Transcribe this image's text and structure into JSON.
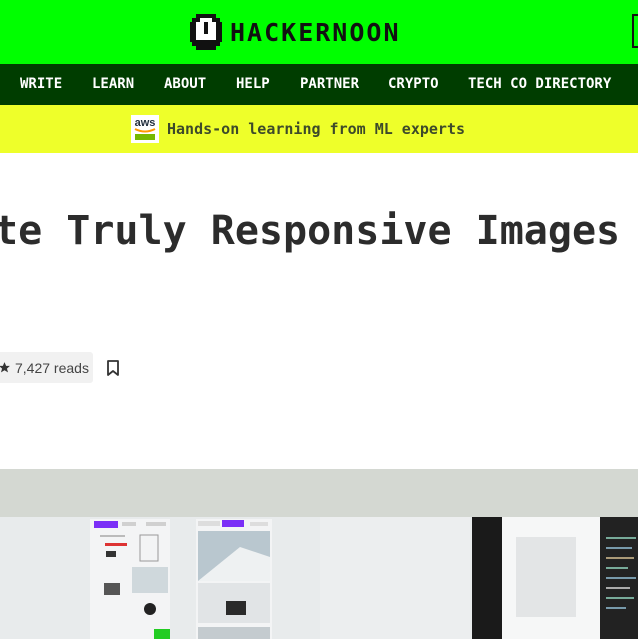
{
  "header": {
    "logo_text": "HACKERNOON"
  },
  "nav": {
    "items": [
      {
        "label": "WRITE"
      },
      {
        "label": "LEARN"
      },
      {
        "label": "ABOUT"
      },
      {
        "label": "HELP"
      },
      {
        "label": "PARTNER"
      },
      {
        "label": "CRYPTO"
      },
      {
        "label": "TECH CO DIRECTORY"
      }
    ]
  },
  "promo": {
    "logo_text": "aws",
    "text": "Hands-on learning from ML experts"
  },
  "article": {
    "title": "te Truly Responsive Images",
    "reads": "7,427 reads"
  },
  "colors": {
    "brand_green": "#00ff00",
    "nav_dark_green": "#003d00",
    "promo_yellow": "#eeff2a"
  },
  "icons": {
    "logo": "hackernoon-helmet-icon",
    "star": "star-icon",
    "bookmark": "bookmark-icon"
  }
}
